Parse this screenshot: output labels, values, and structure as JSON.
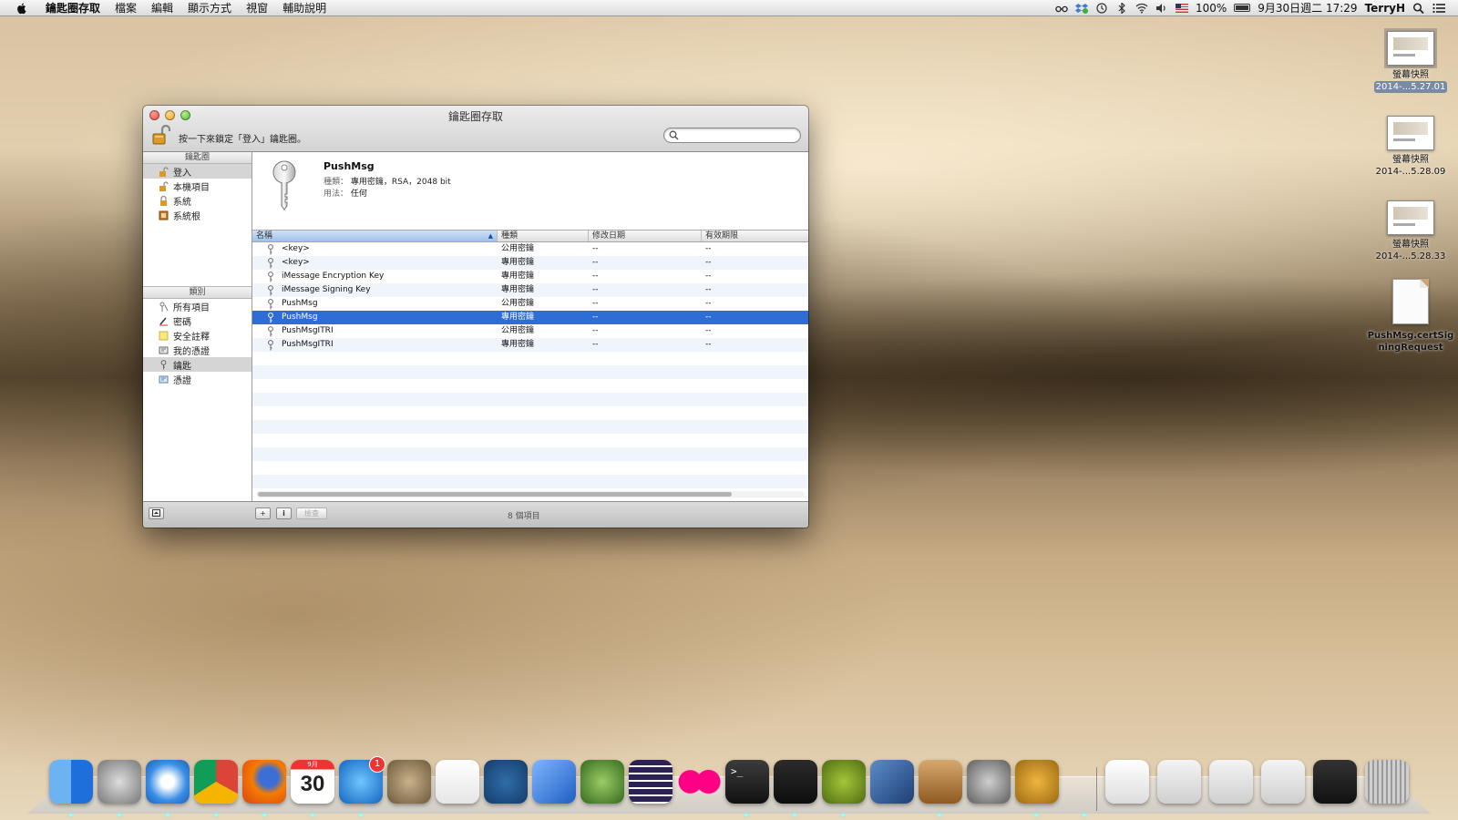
{
  "menubar": {
    "app_name": "鑰匙圈存取",
    "menus": [
      "檔案",
      "編輯",
      "顯示方式",
      "視窗",
      "輔助說明"
    ],
    "battery": "100%",
    "datetime": "9月30日週二  17:29",
    "user": "TerryH"
  },
  "window": {
    "title": "鑰匙圈存取",
    "lock_hint": "按一下來鎖定「登入」鑰匙圈。",
    "search_placeholder": ""
  },
  "sidebar": {
    "keychains_header": "鑰匙圈",
    "keychains": [
      "登入",
      "本機項目",
      "系統",
      "系統根"
    ],
    "selected_keychain": "登入",
    "category_header": "類別",
    "categories": [
      "所有項目",
      "密碼",
      "安全註釋",
      "我的憑證",
      "鑰匙",
      "憑證"
    ],
    "selected_category": "鑰匙"
  },
  "detail": {
    "name": "PushMsg",
    "kind_label": "種類：",
    "kind_value": "專用密鑰，RSA，2048 bit",
    "usage_label": "用法：",
    "usage_value": "任何"
  },
  "table": {
    "columns": [
      "名稱",
      "種類",
      "修改日期",
      "有效期限"
    ],
    "sort_indicator": "▲",
    "rows": [
      {
        "name": "<key>",
        "kind": "公用密鑰",
        "date": "--",
        "expires": "--"
      },
      {
        "name": "<key>",
        "kind": "專用密鑰",
        "date": "--",
        "expires": "--"
      },
      {
        "name": "iMessage Encryption Key",
        "kind": "專用密鑰",
        "date": "--",
        "expires": "--"
      },
      {
        "name": "iMessage Signing Key",
        "kind": "專用密鑰",
        "date": "--",
        "expires": "--"
      },
      {
        "name": "PushMsg",
        "kind": "公用密鑰",
        "date": "--",
        "expires": "--"
      },
      {
        "name": "PushMsg",
        "kind": "專用密鑰",
        "date": "--",
        "expires": "--",
        "selected": true
      },
      {
        "name": "PushMsgITRI",
        "kind": "公用密鑰",
        "date": "--",
        "expires": "--"
      },
      {
        "name": "PushMsgITRI",
        "kind": "專用密鑰",
        "date": "--",
        "expires": "--"
      }
    ]
  },
  "bottombar": {
    "add_label": "+",
    "info_label": "i",
    "verify_label": "檢查",
    "count": "8 個項目"
  },
  "desktop": {
    "icons": [
      {
        "line1": "螢幕快照",
        "line2": "2014-...5.27.01"
      },
      {
        "line1": "螢幕快照",
        "line2": "2014-...5.28.09"
      },
      {
        "line1": "螢幕快照",
        "line2": "2014-...5.28.33"
      },
      {
        "line1": "PushMsg.certSig",
        "line2": "ningRequest"
      }
    ]
  },
  "dock": {
    "apps": [
      "finder-icon",
      "launchpad-icon",
      "safari-icon",
      "chrome-icon",
      "firefox-icon",
      "calendar-icon",
      "app-store-icon",
      "gimp-icon",
      "textedit-icon",
      "sourcetree-icon",
      "xcode-icon",
      "android-tool-icon",
      "eclipse-icon",
      "flickr-icon",
      "terminal-icon",
      "activity-monitor-icon",
      "android-studio-icon",
      "virtualbox-icon",
      "archive-utility-icon",
      "system-preferences-icon",
      "keychain-access-icon"
    ],
    "calendar_day": "30",
    "calendar_month": "9月",
    "app_store_badge": "1",
    "documents": [
      "document-stack-icon",
      "window-thumb-firefox-icon",
      "window-thumb-chrome-icon",
      "window-thumb-chrome-2-icon",
      "window-thumb-terminal-icon",
      "trash-icon"
    ]
  },
  "colors": {
    "selection_blue": "#2e6cd6",
    "window_bg": "#e9e9e9"
  }
}
